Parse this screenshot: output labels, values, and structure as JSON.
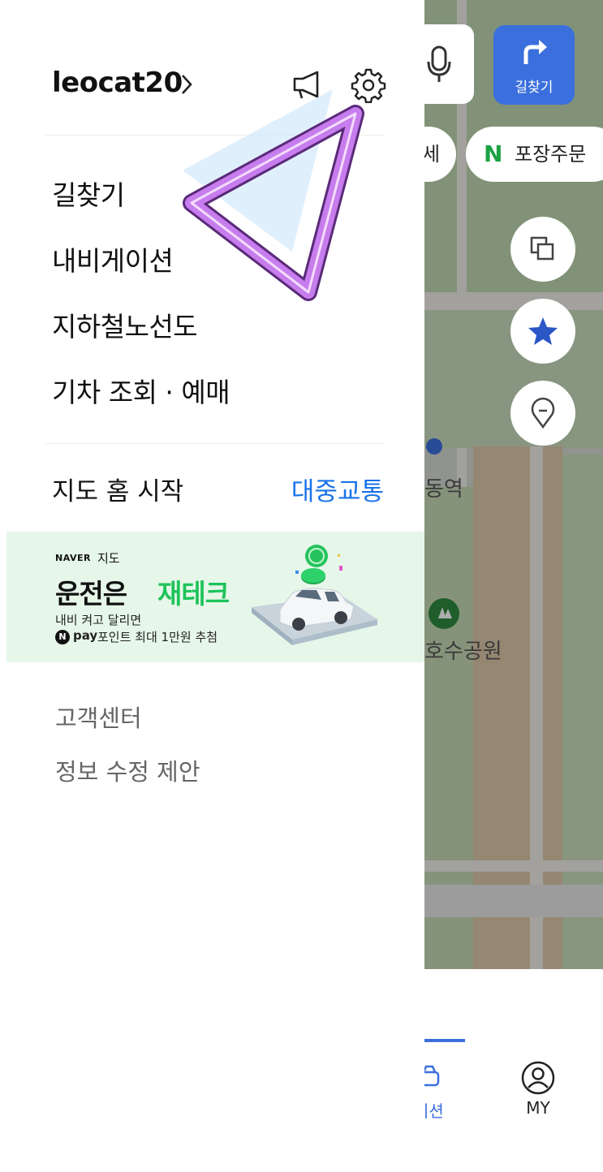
{
  "drawer": {
    "username": "leocat20",
    "menu_items": [
      "길찾기",
      "내비게이션",
      "지하철노선도",
      "기차 조회 · 예매"
    ],
    "map_home_start": {
      "label": "지도 홈 시작",
      "value": "대중교통"
    },
    "banner": {
      "brand": "NAVER",
      "brand_service": "지도",
      "title_part1": "운전은",
      "title_part2": "재테크",
      "subtitle_line1": "내비 켜고 달리면",
      "npay_icon": "N",
      "npay_label": "pay",
      "subtitle_line2": "포인트 최대 1만원 추첨"
    },
    "footer_links": [
      "고객센터",
      "정보 수정 제안"
    ]
  },
  "map": {
    "route_button_label": "길찾기",
    "chip_partial": "세",
    "chip_package": {
      "icon": "N",
      "label": "포장주문"
    },
    "place_label_station": "동역",
    "place_label_park": "호수공원",
    "tabs": {
      "navigation_partial": "이션",
      "my": "MY"
    }
  },
  "colors": {
    "accent_blue": "#1a73e8",
    "banner_bg": "#e6f7e9",
    "banner_green": "#1ec35a",
    "annotation_purple": "#c77ded"
  }
}
